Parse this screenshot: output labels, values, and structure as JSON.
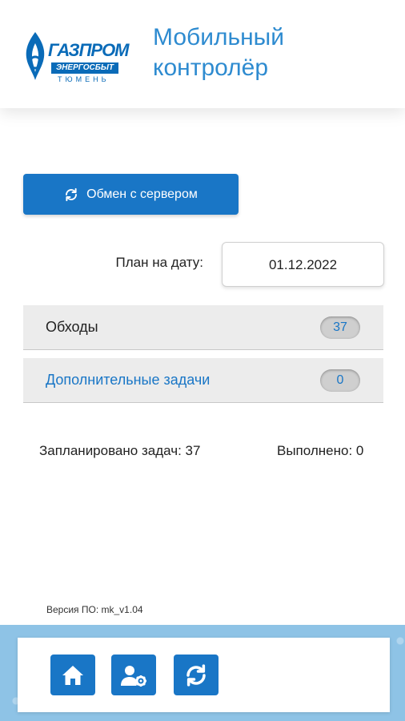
{
  "header": {
    "logo": {
      "word": "ГАЗПРОМ",
      "sub": "ЭНЕРГОСБЫТ",
      "city": "ТЮМЕНЬ"
    },
    "app_title_line1": "Мобильный",
    "app_title_line2": "контролёр"
  },
  "sync_button": {
    "label": "Обмен с сервером",
    "icon": "refresh-icon"
  },
  "plan": {
    "label": "План на дату:",
    "date_value": "01.12.2022"
  },
  "task_rows": [
    {
      "label": "Обходы",
      "count": "37",
      "label_color": "#222222"
    },
    {
      "label": "Дополнительные задачи",
      "count": "0",
      "label_color": "#1976c6"
    }
  ],
  "summary": {
    "planned": "Запланировано задач: 37",
    "done": "Выполнено: 0"
  },
  "version": "Версия ПО: mk_v1.04",
  "bottom_nav": [
    {
      "name": "home",
      "icon": "home-icon"
    },
    {
      "name": "user-settings",
      "icon": "user-gear-icon"
    },
    {
      "name": "sync",
      "icon": "refresh-icon"
    }
  ],
  "colors": {
    "accent": "#1976c6",
    "title": "#2e8bd0",
    "footer_bg": "#8ec3e6"
  }
}
